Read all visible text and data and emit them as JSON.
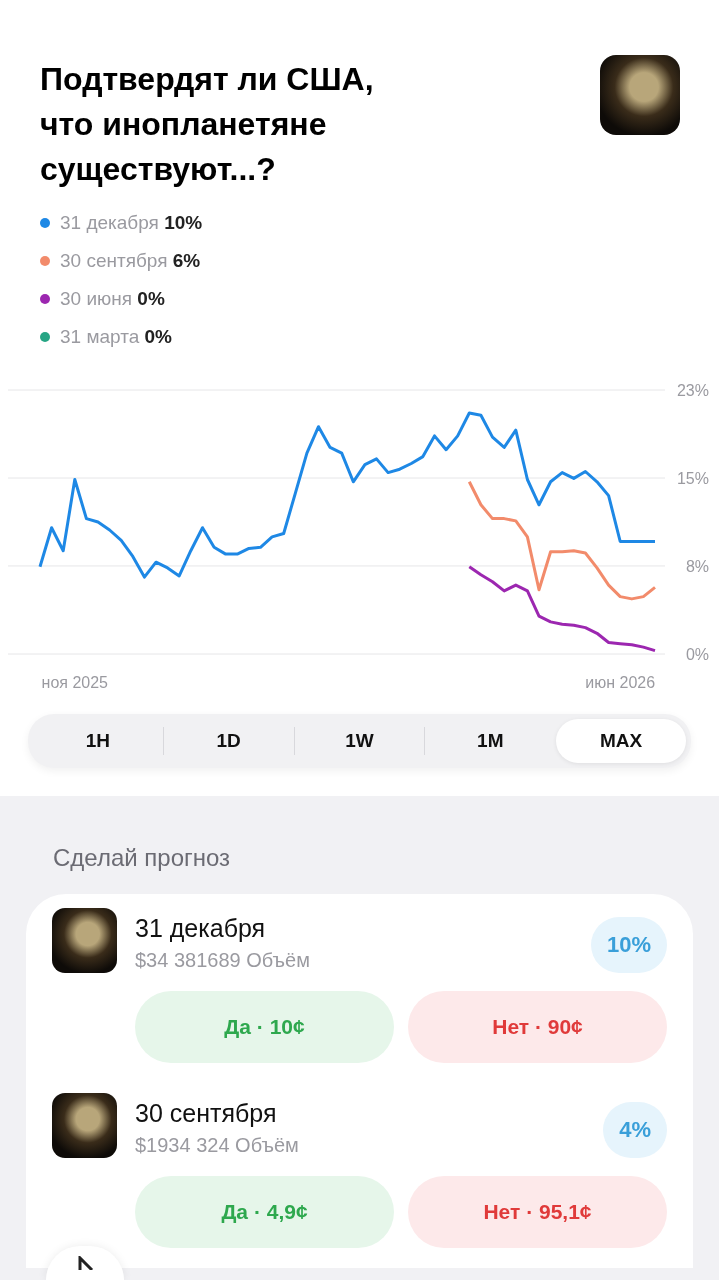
{
  "header": {
    "title": "Подтвердят ли США, что инопланетяне существуют...?"
  },
  "legend": [
    {
      "label": "31 декабря **10%**",
      "color": "#1e88e5"
    },
    {
      "label": "30 сентября **6%**",
      "color": "#f28b6b"
    },
    {
      "label": "30 июня **0%**",
      "color": "#9c27b0"
    },
    {
      "label": "31 марта **0%**",
      "color": "#26a584"
    }
  ],
  "chart": {
    "chart_data": {
      "type": "line",
      "categories": [
        null,
        null,
        null,
        "ноя 2025",
        null,
        null,
        null,
        null,
        null,
        null,
        null,
        null,
        null,
        null,
        null,
        null,
        null,
        null,
        null,
        null,
        null,
        null,
        null,
        null,
        null,
        null,
        null,
        null,
        null,
        null,
        null,
        null,
        null,
        null,
        null,
        null,
        null,
        null,
        null,
        null,
        null,
        null,
        null,
        null,
        null,
        null,
        null,
        null,
        null,
        null,
        "июн 2026",
        null,
        null,
        null
      ],
      "ylim": [
        0,
        23
      ],
      "yticks": [
        {
          "value": 0,
          "label": "0%"
        },
        {
          "value": 7.67,
          "label": "8%"
        },
        {
          "value": 15.33,
          "label": "15%"
        },
        {
          "value": 23,
          "label": "23%"
        }
      ],
      "series": [
        {
          "color": "#1e88e5",
          "values": [
            7.6,
            11.0,
            9.0,
            15.2,
            11.8,
            11.5,
            10.8,
            9.9,
            8.5,
            6.7,
            8.0,
            7.5,
            6.8,
            9.0,
            11.0,
            9.3,
            8.7,
            8.7,
            9.2,
            9.3,
            10.2,
            10.5,
            14.0,
            17.5,
            19.8,
            18.0,
            17.5,
            15.0,
            16.5,
            17.0,
            15.8,
            16.1,
            16.6,
            17.2,
            19.0,
            17.8,
            19.0,
            21.0,
            20.8,
            18.9,
            18.0,
            19.5,
            15.2,
            13.0,
            15.0,
            15.8,
            15.3,
            15.9,
            15.0,
            13.8,
            9.8,
            9.8,
            9.8,
            9.8
          ]
        },
        {
          "color": "#f28b6b",
          "values": [
            null,
            null,
            null,
            null,
            null,
            null,
            null,
            null,
            null,
            null,
            null,
            null,
            null,
            null,
            null,
            null,
            null,
            null,
            null,
            null,
            null,
            null,
            null,
            null,
            null,
            null,
            null,
            null,
            null,
            null,
            null,
            null,
            null,
            null,
            null,
            null,
            null,
            15.0,
            13.0,
            11.8,
            11.8,
            11.6,
            10.2,
            5.6,
            8.9,
            8.9,
            9.0,
            8.8,
            7.5,
            6.0,
            5.0,
            4.8,
            5.0,
            5.8
          ]
        },
        {
          "color": "#9c27b0",
          "values": [
            null,
            null,
            null,
            null,
            null,
            null,
            null,
            null,
            null,
            null,
            null,
            null,
            null,
            null,
            null,
            null,
            null,
            null,
            null,
            null,
            null,
            null,
            null,
            null,
            null,
            null,
            null,
            null,
            null,
            null,
            null,
            null,
            null,
            null,
            null,
            null,
            null,
            7.6,
            6.9,
            6.3,
            5.5,
            6.0,
            5.5,
            3.3,
            2.8,
            2.6,
            2.5,
            2.3,
            1.8,
            1.0,
            0.9,
            0.8,
            0.6,
            0.3
          ]
        }
      ]
    }
  },
  "ranges": [
    {
      "label": "1H",
      "selected": false
    },
    {
      "label": "1D",
      "selected": false
    },
    {
      "label": "1W",
      "selected": false
    },
    {
      "label": "1M",
      "selected": false
    },
    {
      "label": "MAX",
      "selected": true
    }
  ],
  "forecast": {
    "heading": "Сделай прогноз",
    "markets": [
      {
        "name": "31 декабря",
        "volume": "$34 381689 Объём",
        "chance": "10%",
        "yes": "Да · 10¢",
        "no": "Нет · 90¢"
      },
      {
        "name": "30 сентября",
        "volume": "$1934 324 Объём",
        "chance": "4%",
        "yes": "Да · 4,9¢",
        "no": "Нет · 95,1¢"
      }
    ]
  }
}
